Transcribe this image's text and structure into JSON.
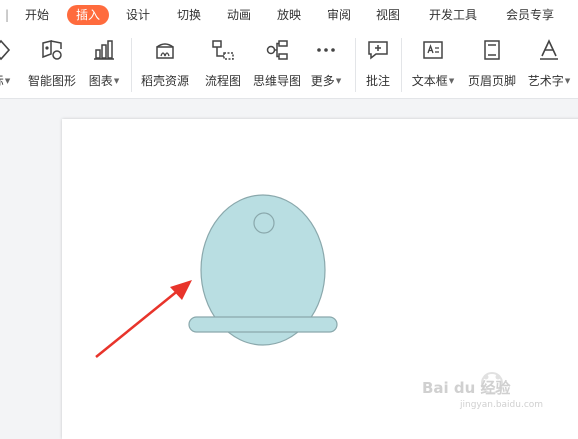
{
  "menu": {
    "tabs": [
      {
        "label": "开始"
      },
      {
        "label": "插入"
      },
      {
        "label": "设计"
      },
      {
        "label": "切换"
      },
      {
        "label": "动画"
      },
      {
        "label": "放映"
      },
      {
        "label": "审阅"
      },
      {
        "label": "视图"
      },
      {
        "label": "开发工具"
      },
      {
        "label": "会员专享"
      }
    ],
    "active_tab": "插入"
  },
  "ribbon": {
    "partial_left_label": "标",
    "smartart_label": "智能图形",
    "chart_label": "图表",
    "daoke_label": "稻壳资源",
    "flowchart_label": "流程图",
    "mindmap_label": "思维导图",
    "more_label": "更多",
    "comment_label": "批注",
    "textbox_label": "文本框",
    "header_footer_label": "页眉页脚",
    "wordart_label": "艺术字"
  },
  "colors": {
    "accent": "#ff6b3d",
    "shape_fill": "#b9dee2",
    "shape_stroke": "#8aa8ac",
    "arrow": "#e8342b"
  },
  "icons": [
    "shapes-icon",
    "smartart-icon",
    "chart-icon",
    "daoke-icon",
    "flowchart-icon",
    "mindmap-icon",
    "more-icon",
    "comment-icon",
    "textbox-icon",
    "header-footer-icon",
    "wordart-icon"
  ],
  "watermark": {
    "brand": "Bai du 经验",
    "url": "jingyan.baidu.com"
  }
}
